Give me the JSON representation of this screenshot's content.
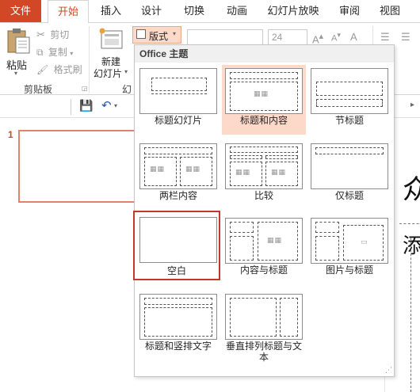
{
  "tabs": {
    "file": "文件",
    "home": "开始",
    "insert": "插入",
    "design": "设计",
    "transitions": "切换",
    "animations": "动画",
    "slideshow": "幻灯片放映",
    "review": "审阅",
    "view": "视图"
  },
  "clipboard": {
    "paste": "粘贴",
    "cut": "剪切",
    "copy": "复制",
    "format_painter": "格式刷",
    "group": "剪贴板"
  },
  "slides": {
    "new_slide_line1": "新建",
    "new_slide_line2": "幻灯片",
    "group_partial": "幻",
    "layout_button": "版式"
  },
  "font": {
    "size": "24"
  },
  "slide_pane": {
    "slide_number": "1"
  },
  "canvas_partial": {
    "char1": "众",
    "char2": "添"
  },
  "layout_menu": {
    "header": "Office 主题",
    "items": [
      {
        "label": "标题幻灯片"
      },
      {
        "label": "标题和内容"
      },
      {
        "label": "节标题"
      },
      {
        "label": "两栏内容"
      },
      {
        "label": "比较"
      },
      {
        "label": "仅标题"
      },
      {
        "label": "空白"
      },
      {
        "label": "内容与标题"
      },
      {
        "label": "图片与标题"
      },
      {
        "label": "标题和竖排文字"
      },
      {
        "label": "垂直排列标题与文本"
      }
    ]
  },
  "colors": {
    "accent": "#D24726",
    "hover_highlight": "#FCD9C9",
    "selection_border": "#C0392B"
  }
}
